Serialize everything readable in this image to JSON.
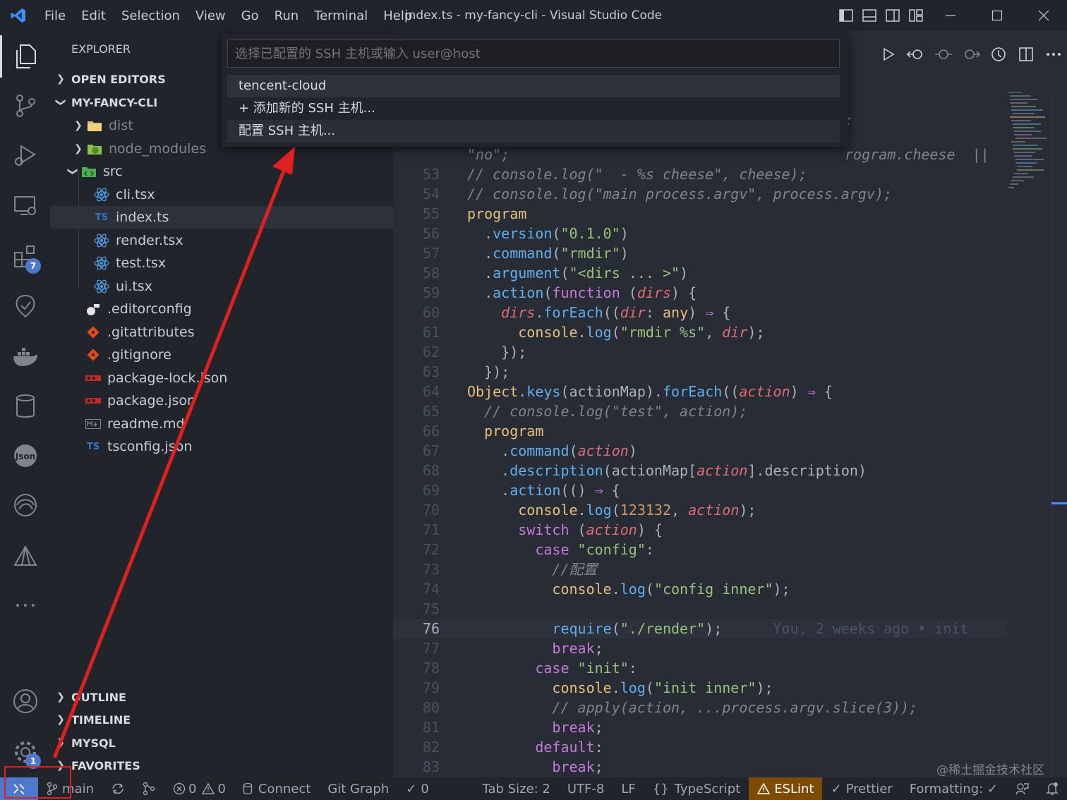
{
  "titlebar": {
    "menu": [
      "File",
      "Edit",
      "Selection",
      "View",
      "Go",
      "Run",
      "Terminal",
      "Help"
    ],
    "window_title": "index.ts - my-fancy-cli - Visual Studio Code"
  },
  "activitybar": {
    "extensions_badge": "7",
    "settings_badge": "1"
  },
  "sidebar": {
    "header": "EXPLORER",
    "sections": {
      "open_editors": "OPEN EDITORS",
      "project": "MY-FANCY-CLI",
      "outline": "OUTLINE",
      "timeline": "TIMELINE",
      "mysql": "MYSQL",
      "favorites": "FAVORITES"
    },
    "tree": [
      {
        "name": "dist",
        "kind": "folder"
      },
      {
        "name": "node_modules",
        "kind": "folder"
      },
      {
        "name": "src",
        "kind": "folder"
      },
      {
        "name": "cli.tsx",
        "kind": "react"
      },
      {
        "name": "index.ts",
        "kind": "ts"
      },
      {
        "name": "render.tsx",
        "kind": "react"
      },
      {
        "name": "test.tsx",
        "kind": "react"
      },
      {
        "name": "ui.tsx",
        "kind": "react"
      },
      {
        "name": ".editorconfig",
        "kind": "config"
      },
      {
        "name": ".gitattributes",
        "kind": "git"
      },
      {
        "name": ".gitignore",
        "kind": "git"
      },
      {
        "name": "package-lock.json",
        "kind": "npm"
      },
      {
        "name": "package.json",
        "kind": "npm"
      },
      {
        "name": "readme.md",
        "kind": "md"
      },
      {
        "name": "tsconfig.json",
        "kind": "tsconfig"
      }
    ]
  },
  "quickpick": {
    "placeholder": "选择已配置的 SSH 主机或输入 user@host",
    "items": [
      "tencent-cloud",
      "+ 添加新的 SSH 主机...",
      "配置 SSH 主机..."
    ]
  },
  "editor": {
    "partial_top_right_1": ";",
    "partial_top_right_2": "rogram.cheese  ||",
    "partial_line": "\"no\";",
    "blame": "You, 2 weeks ago • init",
    "current_line": "76",
    "lines": [
      {
        "n": "53",
        "text": "// console.log(\"  - %s cheese\", cheese);"
      },
      {
        "n": "54",
        "text": "// console.log(\"main process.argv\", process.argv);"
      },
      {
        "n": "55",
        "text": "program"
      },
      {
        "n": "56",
        "text": "  .version(\"0.1.0\")"
      },
      {
        "n": "57",
        "text": "  .command(\"rmdir\")"
      },
      {
        "n": "58",
        "text": "  .argument(\"<dirs ... >\")"
      },
      {
        "n": "59",
        "text": "  .action(function (dirs) {"
      },
      {
        "n": "60",
        "text": "    dirs.forEach((dir: any) ⇒ {"
      },
      {
        "n": "61",
        "text": "      console.log(\"rmdir %s\", dir);"
      },
      {
        "n": "62",
        "text": "    });"
      },
      {
        "n": "63",
        "text": "  });"
      },
      {
        "n": "64",
        "text": "Object.keys(actionMap).forEach((action) ⇒ {"
      },
      {
        "n": "65",
        "text": "  // console.log(\"test\", action);"
      },
      {
        "n": "66",
        "text": "  program"
      },
      {
        "n": "67",
        "text": "    .command(action)"
      },
      {
        "n": "68",
        "text": "    .description(actionMap[action].description)"
      },
      {
        "n": "69",
        "text": "    .action(() ⇒ {"
      },
      {
        "n": "70",
        "text": "      console.log(123132, action);"
      },
      {
        "n": "71",
        "text": "      switch (action) {"
      },
      {
        "n": "72",
        "text": "        case \"config\":"
      },
      {
        "n": "73",
        "text": "          //配置"
      },
      {
        "n": "74",
        "text": "          console.log(\"config inner\");"
      },
      {
        "n": "75",
        "text": ""
      },
      {
        "n": "76",
        "text": "          require(\"./render\");"
      },
      {
        "n": "77",
        "text": "          break;"
      },
      {
        "n": "78",
        "text": "        case \"init\":"
      },
      {
        "n": "79",
        "text": "          console.log(\"init inner\");"
      },
      {
        "n": "80",
        "text": "          // apply(action, ...process.argv.slice(3));"
      },
      {
        "n": "81",
        "text": "          break;"
      },
      {
        "n": "82",
        "text": "        default:"
      },
      {
        "n": "83",
        "text": "          break;"
      }
    ]
  },
  "watermark": "@稀土掘金技术社区",
  "statusbar": {
    "branch": "main",
    "errors": "0",
    "warnings": "0",
    "connect": "Connect",
    "git_graph": "Git Graph",
    "check_count": "0",
    "tab_size": "Tab Size: 2",
    "encoding": "UTF-8",
    "eol": "LF",
    "language": "TypeScript",
    "eslint": "ESLint",
    "prettier": "Prettier",
    "formatting": "Formatting: ✓"
  },
  "colors": {
    "accent": "#4d78cc",
    "annotation": "#e02020",
    "editor_bg": "#282c34",
    "sidebar_bg": "#21252b"
  }
}
